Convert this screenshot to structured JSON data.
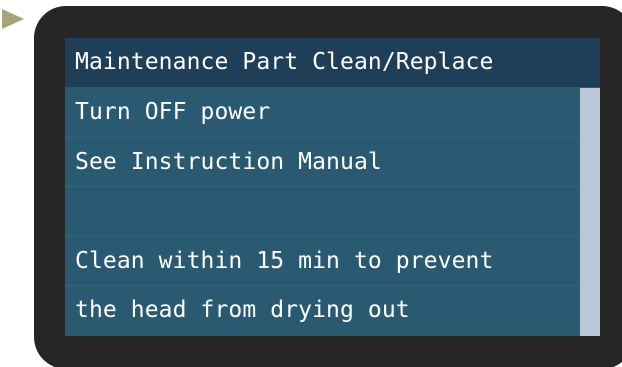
{
  "display": {
    "header": {
      "title": "Maintenance Part Clean/Replace"
    },
    "message_lines": [
      "Turn OFF power",
      "See Instruction Manual",
      "",
      "Clean within 15 min to prevent",
      "the head from drying out"
    ]
  },
  "indicator": {
    "icon": "play-triangle-icon",
    "color": "#a8a57a"
  },
  "colors": {
    "bezel": "#262626",
    "screen_background": "#295a72",
    "header_background": "#1e3f57",
    "text": "#ffffff",
    "scrollbar_thumb": "#b9c7d9"
  }
}
